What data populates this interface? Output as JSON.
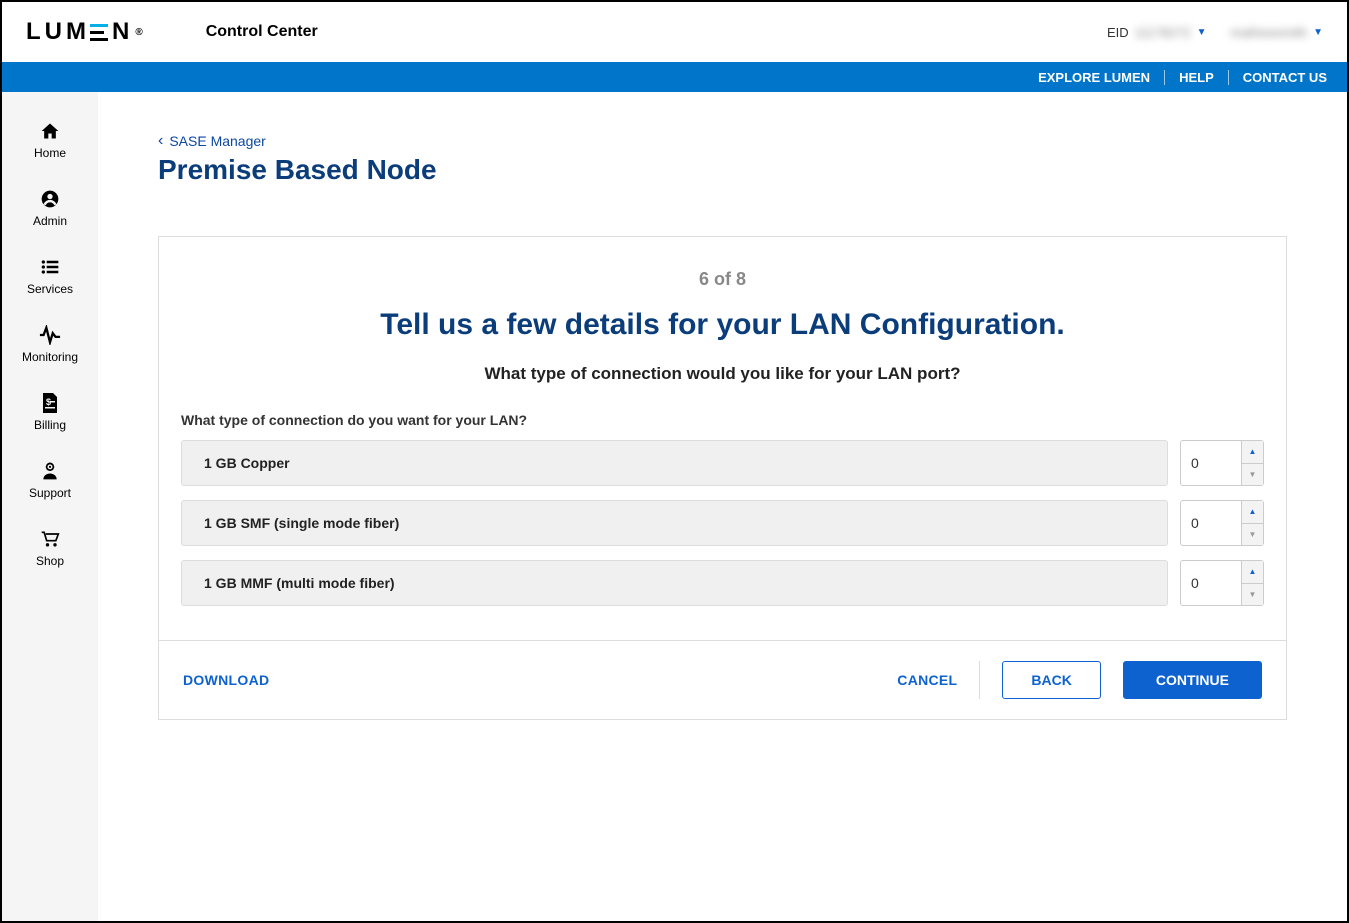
{
  "header": {
    "logo_text": "LUMEN",
    "logo_reg": "®",
    "app_title": "Control Center",
    "eid_label": "EID",
    "eid_value": "11178272",
    "user_value": "mathewsmith"
  },
  "topnav": {
    "explore": "EXPLORE LUMEN",
    "help": "HELP",
    "contact": "CONTACT US"
  },
  "sidebar": {
    "items": [
      {
        "label": "Home"
      },
      {
        "label": "Admin"
      },
      {
        "label": "Services"
      },
      {
        "label": "Monitoring"
      },
      {
        "label": "Billing"
      },
      {
        "label": "Support"
      },
      {
        "label": "Shop"
      }
    ]
  },
  "breadcrumb": {
    "parent": "SASE Manager"
  },
  "page": {
    "title": "Premise Based Node"
  },
  "wizard": {
    "step_text": "6 of 8",
    "title": "Tell us a few details for your LAN Configuration.",
    "subtitle": "What type of connection would you like for your LAN port?",
    "section_label": "What type of connection do you want for your LAN?",
    "options": [
      {
        "name": "1 GB Copper",
        "qty": "0"
      },
      {
        "name": "1 GB SMF (single mode fiber)",
        "qty": "0"
      },
      {
        "name": "1 GB MMF (multi mode fiber)",
        "qty": "0"
      }
    ],
    "footer": {
      "download": "DOWNLOAD",
      "cancel": "CANCEL",
      "back": "BACK",
      "continue": "CONTINUE"
    }
  }
}
